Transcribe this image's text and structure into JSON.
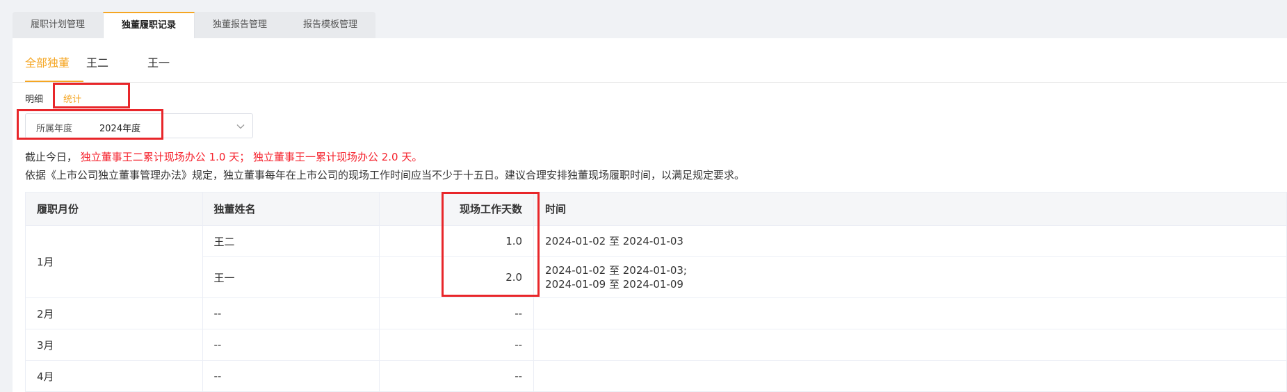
{
  "page_tabs": [
    {
      "label": "履职计划管理"
    },
    {
      "label": "独董履职记录"
    },
    {
      "label": "独董报告管理"
    },
    {
      "label": "报告模板管理"
    }
  ],
  "director_tabs": [
    {
      "label": "全部独董"
    },
    {
      "label": "王二"
    },
    {
      "label": "王一"
    }
  ],
  "view_tabs": [
    {
      "label": "明细"
    },
    {
      "label": "统计"
    }
  ],
  "year_filter": {
    "label": "所属年度",
    "value": "2024年度"
  },
  "notice": {
    "prefix": "截止今日，",
    "red_text": "独立董事王二累计现场办公 1.0 天； 独立董事王一累计现场办公 2.0 天。",
    "regulation": "依据《上市公司独立董事管理办法》规定，独立董事每年在上市公司的现场工作时间应当不少于十五日。建议合理安排独董现场履职时间，以满足规定要求。"
  },
  "table": {
    "headers": [
      "履职月份",
      "独董姓名",
      "现场工作天数",
      "时间"
    ],
    "jan": {
      "month": "1月",
      "rows": [
        {
          "name": "王二",
          "days": "1.0",
          "time1": "2024-01-02 至 2024-01-03",
          "time2": ""
        },
        {
          "name": "王一",
          "days": "2.0",
          "time1": "2024-01-02 至 2024-01-03;",
          "time2": "2024-01-09 至 2024-01-09"
        }
      ]
    },
    "other_rows": [
      {
        "month": "2月",
        "name": "--",
        "days": "--",
        "time": ""
      },
      {
        "month": "3月",
        "name": "--",
        "days": "--",
        "time": ""
      },
      {
        "month": "4月",
        "name": "--",
        "days": "--",
        "time": ""
      }
    ]
  },
  "colors": {
    "accent": "#f5a623",
    "highlight_box": "#e8262a",
    "warning_text": "#f5222d"
  }
}
